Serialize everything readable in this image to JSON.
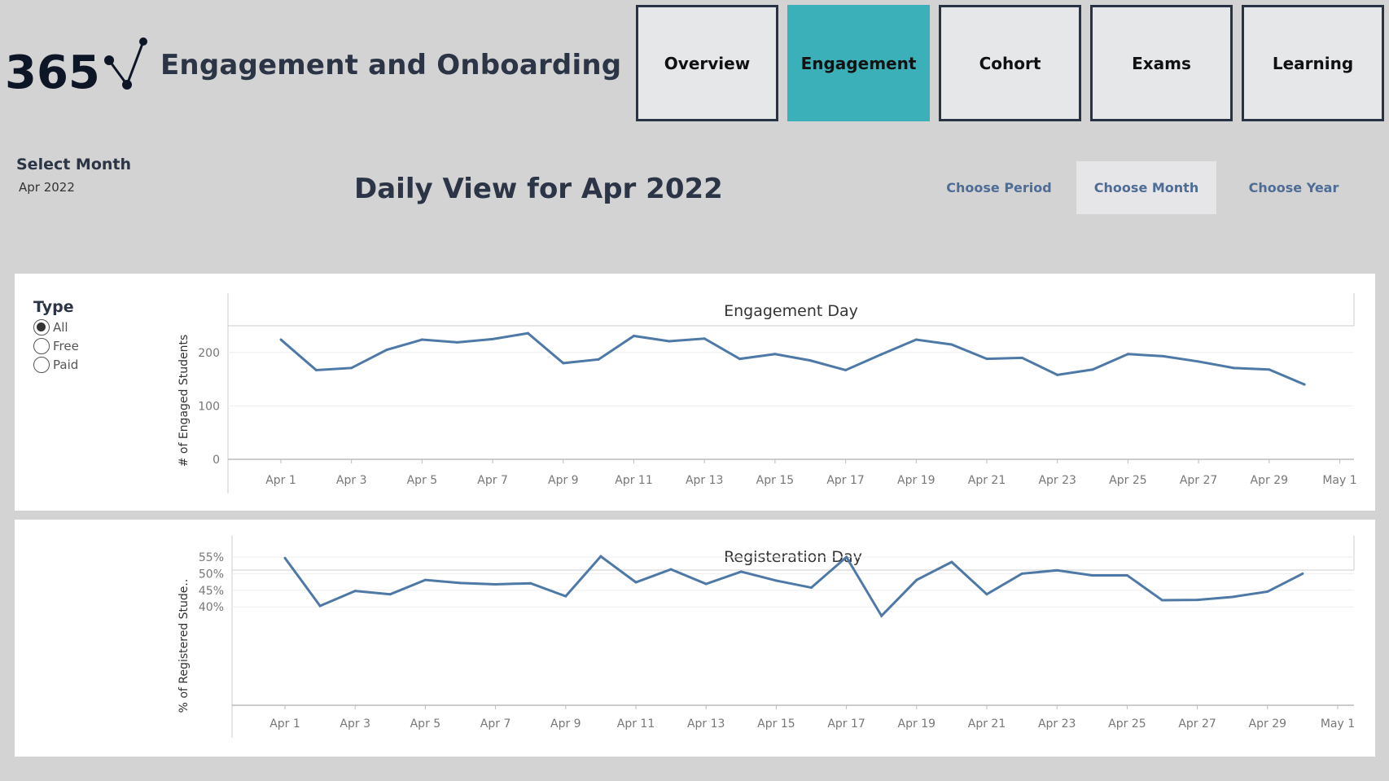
{
  "header": {
    "logo_text": "365",
    "title": "Engagement and Onboarding"
  },
  "nav": {
    "tabs": [
      {
        "label": "Overview",
        "active": false
      },
      {
        "label": "Engagement",
        "active": true
      },
      {
        "label": "Cohort",
        "active": false
      },
      {
        "label": "Exams",
        "active": false
      },
      {
        "label": "Learning",
        "active": false
      }
    ]
  },
  "month_filter": {
    "label": "Select Month",
    "value": "Apr 2022"
  },
  "view_title": "Daily View for Apr 2022",
  "period_buttons": [
    {
      "label": "Choose Period",
      "active": false
    },
    {
      "label": "Choose Month",
      "active": true
    },
    {
      "label": "Choose Year",
      "active": false
    }
  ],
  "type_filter": {
    "title": "Type",
    "options": [
      {
        "label": "All",
        "checked": true
      },
      {
        "label": "Free",
        "checked": false
      },
      {
        "label": "Paid",
        "checked": false
      }
    ]
  },
  "colors": {
    "accent": "#3cb0b8",
    "line": "#4e79a7",
    "dark": "#283446",
    "period_text": "#4e6d96"
  },
  "chart_data": [
    {
      "type": "line",
      "title": "Engagement Day",
      "ylabel": "# of Engaged Students",
      "xlabel": "",
      "x_ticks": [
        "Apr 1",
        "Apr 3",
        "Apr 5",
        "Apr 7",
        "Apr 9",
        "Apr 11",
        "Apr 13",
        "Apr 15",
        "Apr 17",
        "Apr 19",
        "Apr 21",
        "Apr 23",
        "Apr 25",
        "Apr 27",
        "Apr 29",
        "May 1"
      ],
      "y_ticks": [
        "0",
        "100",
        "200"
      ],
      "ylim": [
        0,
        250
      ],
      "x": [
        "Apr 1",
        "Apr 2",
        "Apr 3",
        "Apr 4",
        "Apr 5",
        "Apr 6",
        "Apr 7",
        "Apr 8",
        "Apr 9",
        "Apr 10",
        "Apr 11",
        "Apr 12",
        "Apr 13",
        "Apr 14",
        "Apr 15",
        "Apr 16",
        "Apr 17",
        "Apr 18",
        "Apr 19",
        "Apr 20",
        "Apr 21",
        "Apr 22",
        "Apr 23",
        "Apr 24",
        "Apr 25",
        "Apr 26",
        "Apr 27",
        "Apr 28",
        "Apr 29",
        "Apr 30"
      ],
      "values": [
        224,
        167,
        171,
        205,
        224,
        219,
        225,
        236,
        180,
        187,
        231,
        221,
        226,
        188,
        197,
        185,
        167,
        196,
        224,
        215,
        188,
        190,
        158,
        168,
        197,
        193,
        183,
        171,
        168,
        140
      ],
      "grid": true
    },
    {
      "type": "line",
      "title": "Registeration Day",
      "ylabel": "% of Registered Stude..",
      "xlabel": "",
      "x_ticks": [
        "Apr 1",
        "Apr 3",
        "Apr 5",
        "Apr 7",
        "Apr 9",
        "Apr 11",
        "Apr 13",
        "Apr 15",
        "Apr 17",
        "Apr 19",
        "Apr 21",
        "Apr 23",
        "Apr 25",
        "Apr 27",
        "Apr 29",
        "May 1"
      ],
      "y_ticks": [
        "40%",
        "45%",
        "50%",
        "55%"
      ],
      "ylim": [
        36,
        58
      ],
      "x": [
        "Apr 1",
        "Apr 2",
        "Apr 3",
        "Apr 4",
        "Apr 5",
        "Apr 6",
        "Apr 7",
        "Apr 8",
        "Apr 9",
        "Apr 10",
        "Apr 11",
        "Apr 12",
        "Apr 13",
        "Apr 14",
        "Apr 15",
        "Apr 16",
        "Apr 17",
        "Apr 18",
        "Apr 19",
        "Apr 20",
        "Apr 21",
        "Apr 22",
        "Apr 23",
        "Apr 24",
        "Apr 25",
        "Apr 26",
        "Apr 27",
        "Apr 28",
        "Apr 29",
        "Apr 30"
      ],
      "values": [
        54.7,
        40.3,
        44.8,
        43.8,
        48.1,
        47.2,
        46.8,
        47.1,
        43.2,
        55.2,
        47.4,
        51.3,
        46.9,
        50.6,
        47.9,
        45.8,
        55.0,
        37.3,
        48.1,
        53.5,
        43.8,
        50.0,
        51.0,
        49.5,
        49.5,
        42.0,
        42.1,
        43.0,
        44.6,
        50.0
      ],
      "grid": true
    }
  ]
}
